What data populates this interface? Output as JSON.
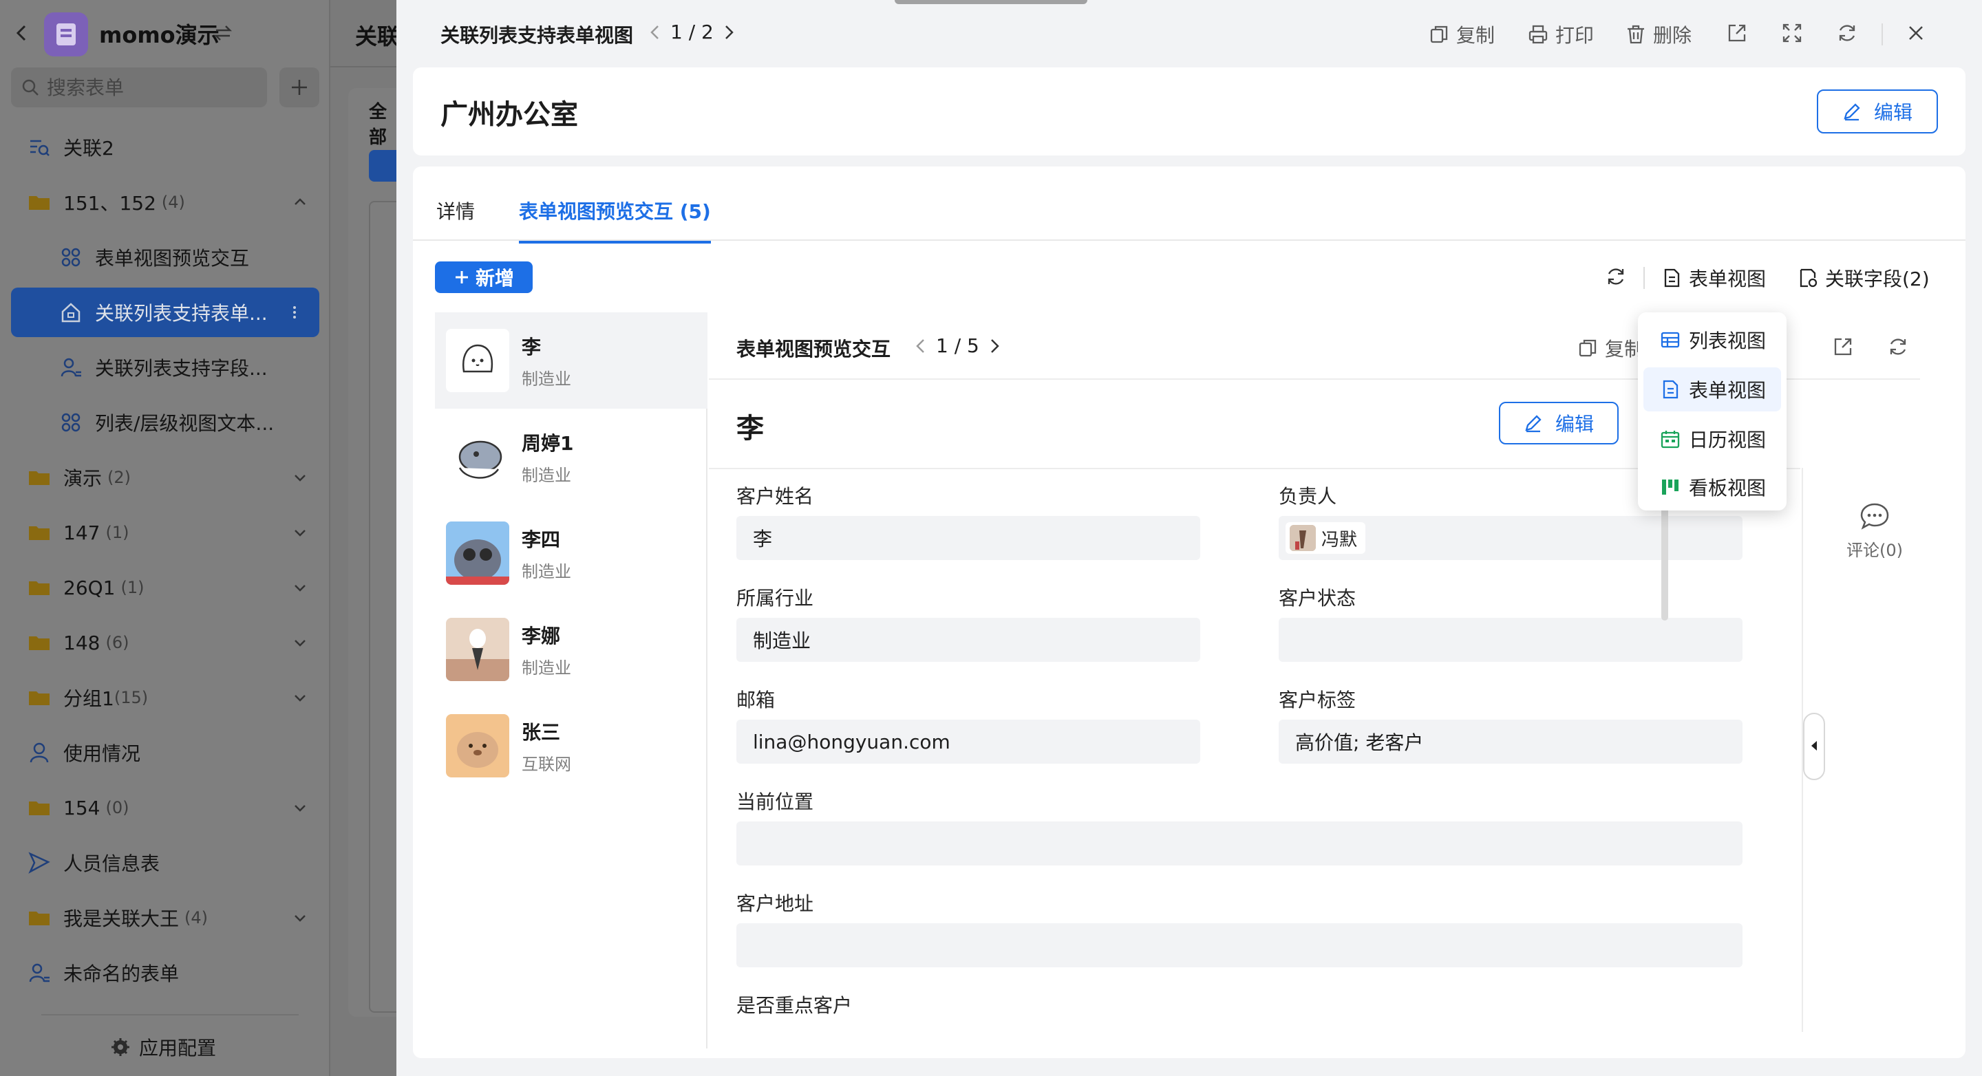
{
  "sidebar": {
    "app_name": "momo演示",
    "search_placeholder": "搜索表单",
    "items": [
      {
        "label": "关联2",
        "count": ""
      },
      {
        "label": "151、152",
        "count": "(4)"
      },
      {
        "label": "表单视图预览交互",
        "count": ""
      },
      {
        "label": "关联列表支持表单...",
        "count": ""
      },
      {
        "label": "关联列表支持字段...",
        "count": ""
      },
      {
        "label": "列表/层级视图文本...",
        "count": ""
      },
      {
        "label": "演示",
        "count": "(2)"
      },
      {
        "label": "147",
        "count": "(1)"
      },
      {
        "label": "26Q1",
        "count": "(1)"
      },
      {
        "label": "148",
        "count": "(6)"
      },
      {
        "label": "分组1",
        "count": "(15)"
      },
      {
        "label": "使用情况",
        "count": ""
      },
      {
        "label": "154",
        "count": "(0)"
      },
      {
        "label": "人员信息表",
        "count": ""
      },
      {
        "label": "我是关联大王",
        "count": "(4)"
      },
      {
        "label": "未命名的表单",
        "count": ""
      }
    ],
    "config_label": "应用配置"
  },
  "background_page": {
    "title": "关联",
    "all_label": "全部"
  },
  "drawer": {
    "title": "关联列表支持表单视图",
    "pager": "1 / 2",
    "actions": {
      "copy": "复制",
      "print": "打印",
      "delete": "删除"
    },
    "record_title": "广州办公室",
    "edit_label": "编辑",
    "tabs": [
      {
        "label": "详情"
      },
      {
        "label": "表单视图预览交互 (5)"
      }
    ],
    "subtoolbar": {
      "add_label": "新增",
      "view_label": "表单视图",
      "related_fields_label": "关联字段(2)"
    },
    "list": [
      {
        "name": "李",
        "industry": "制造业"
      },
      {
        "name": "周婷1",
        "industry": "制造业"
      },
      {
        "name": "李四",
        "industry": "制造业"
      },
      {
        "name": "李娜",
        "industry": "制造业"
      },
      {
        "name": "张三",
        "industry": "互联网"
      }
    ],
    "detail": {
      "title": "表单视图预览交互",
      "pager": "1 / 5",
      "copy_label": "复制",
      "record_name": "李",
      "edit_label": "编辑",
      "fields": {
        "customer_name_label": "客户姓名",
        "customer_name_value": "李",
        "owner_label": "负责人",
        "owner_value": "冯默",
        "industry_label": "所属行业",
        "industry_value": "制造业",
        "status_label": "客户状态",
        "status_value": "",
        "email_label": "邮箱",
        "email_value": "lina@hongyuan.com",
        "tags_label": "客户标签",
        "tags_value": "高价值; 老客户",
        "location_label": "当前位置",
        "location_value": "",
        "address_label": "客户地址",
        "address_value": "",
        "key_customer_label": "是否重点客户"
      }
    },
    "view_menu": [
      {
        "label": "列表视图",
        "icon": "table-icon"
      },
      {
        "label": "表单视图",
        "icon": "form-icon"
      },
      {
        "label": "日历视图",
        "icon": "calendar-icon"
      },
      {
        "label": "看板视图",
        "icon": "kanban-icon"
      }
    ],
    "comment_label": "评论(0)"
  },
  "colors": {
    "accent": "#1d6fe6",
    "overlay_gray": "#7f7f7f",
    "active_nav": "#1f4f9f"
  }
}
